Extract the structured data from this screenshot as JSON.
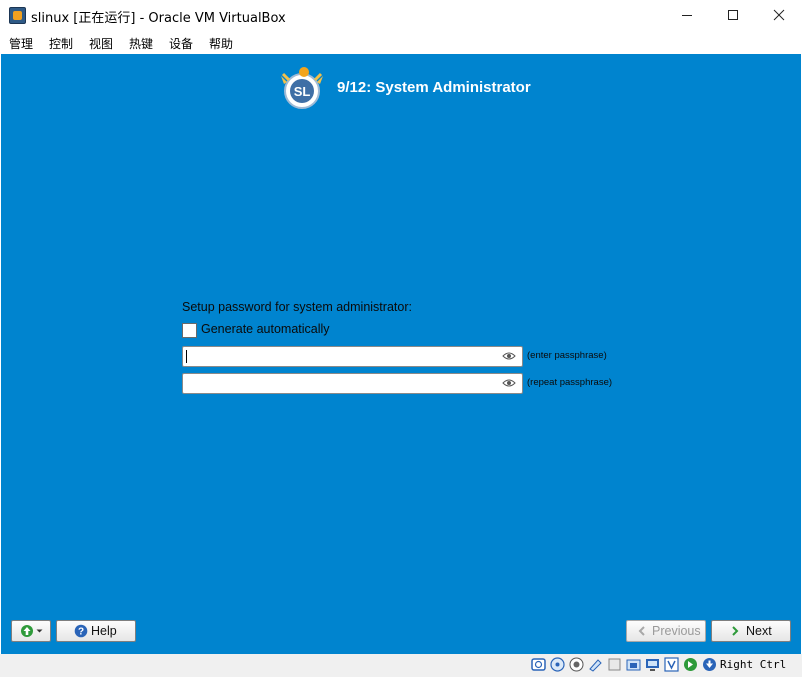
{
  "window": {
    "title": "slinux [正在运行] - Oracle VM VirtualBox",
    "controls": [
      "minimize-icon",
      "maximize-icon",
      "close-icon"
    ]
  },
  "menubar": {
    "items": [
      "管理",
      "控制",
      "视图",
      "热键",
      "设备",
      "帮助"
    ]
  },
  "installer": {
    "step_title": "9/12: System Administrator",
    "prompt": "Setup password for system administrator:",
    "generate_label": "Generate automatically",
    "generate_checked": false,
    "password_value": "",
    "password_hint": "(enter passphrase)",
    "repeat_value": "",
    "repeat_hint": "(repeat passphrase)",
    "buttons": {
      "help": "Help",
      "previous": "Previous",
      "next": "Next"
    },
    "background_color": "#0084cf"
  },
  "statusbar": {
    "icons": [
      "hard-disk-icon",
      "optical-drive-icon",
      "audio-icon",
      "network-icon",
      "usb-icon",
      "shared-folders-icon",
      "display-icon",
      "video-capture-icon",
      "mouse-integration-icon",
      "keyboard-icon"
    ],
    "host_key": "Right Ctrl"
  }
}
